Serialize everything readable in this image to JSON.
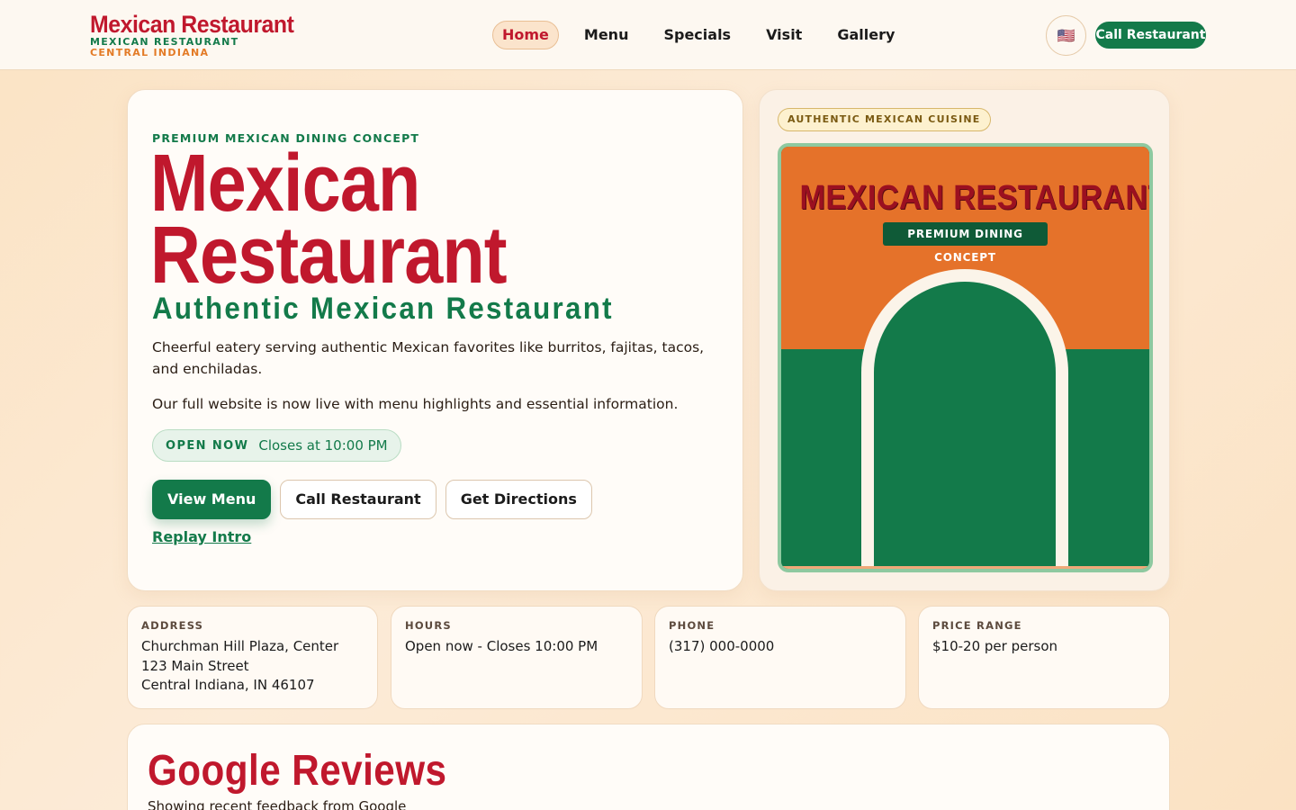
{
  "brand": {
    "title": "Mexican Restaurant",
    "subtitle": "MEXICAN RESTAURANT",
    "location": "CENTRAL INDIANA"
  },
  "nav": {
    "items": [
      {
        "label": "Home",
        "active": true
      },
      {
        "label": "Menu",
        "active": false
      },
      {
        "label": "Specials",
        "active": false
      },
      {
        "label": "Visit",
        "active": false
      },
      {
        "label": "Gallery",
        "active": false
      }
    ],
    "language_flag": "🇺🇸",
    "call_label": "Call Restaurant"
  },
  "hero": {
    "eyebrow": "PREMIUM MEXICAN DINING CONCEPT",
    "title_line1": "Mexican",
    "title_line2": "Restaurant",
    "subtitle": "Authentic Mexican Restaurant",
    "description": "Cheerful eatery serving authentic Mexican favorites like burritos, fajitas, tacos, and enchiladas.",
    "notice": "Our full website is now live with menu highlights and essential information.",
    "status_label": "OPEN NOW",
    "status_time": "Closes at 10:00 PM",
    "buttons": {
      "view_menu": "View Menu",
      "call": "Call Restaurant",
      "directions": "Get Directions"
    },
    "replay_label": "Replay Intro"
  },
  "feature": {
    "badge": "AUTHENTIC MEXICAN CUISINE",
    "poster_title": "MEXICAN RESTAURANT",
    "poster_chip": "PREMIUM DINING CONCEPT"
  },
  "info": {
    "address": {
      "label": "ADDRESS",
      "value": "Churchman Hill Plaza, Center\n123 Main Street\nCentral Indiana, IN 46107"
    },
    "hours": {
      "label": "HOURS",
      "value": "Open now - Closes 10:00 PM"
    },
    "phone": {
      "label": "PHONE",
      "value": "(317) 000-0000"
    },
    "price": {
      "label": "PRICE RANGE",
      "value": "$10-20 per person"
    }
  },
  "reviews": {
    "title": "Google Reviews",
    "subtitle": "Showing recent feedback from Google"
  },
  "colors": {
    "brand_red": "#c0182d",
    "brand_green": "#137a4a",
    "brand_orange": "#e5722a"
  }
}
